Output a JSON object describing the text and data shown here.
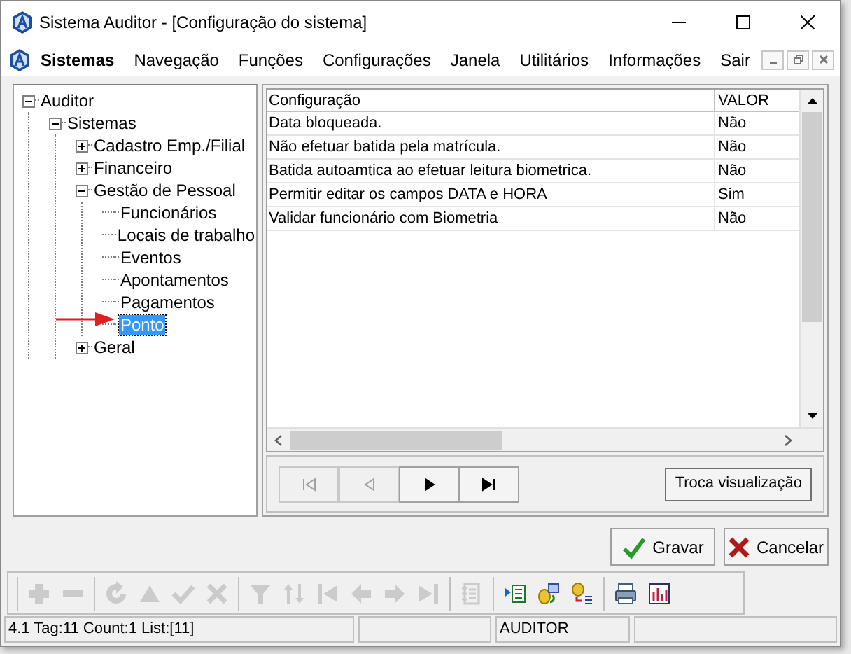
{
  "window": {
    "title": "Sistema Auditor - [Configuração do sistema]"
  },
  "menu": [
    {
      "label": "Sistemas",
      "selected": true
    },
    {
      "label": "Navegação",
      "selected": false
    },
    {
      "label": "Funções",
      "selected": false
    },
    {
      "label": "Configurações",
      "selected": false
    },
    {
      "label": "Janela",
      "selected": false
    },
    {
      "label": "Utilitários",
      "selected": false
    },
    {
      "label": "Informações",
      "selected": false
    },
    {
      "label": "Sair",
      "selected": false
    }
  ],
  "tree": [
    {
      "label": "Auditor",
      "expanded": true,
      "selected": false,
      "children": [
        {
          "label": "Sistemas",
          "expanded": true,
          "selected": false,
          "children": [
            {
              "label": "Cadastro Emp./Filial",
              "expanded": false,
              "selected": false
            },
            {
              "label": "Financeiro",
              "expanded": false,
              "selected": false
            },
            {
              "label": "Gestão de Pessoal",
              "expanded": true,
              "selected": false,
              "children": [
                {
                  "label": "Funcionários",
                  "selected": false
                },
                {
                  "label": "Locais de trabalho",
                  "selected": false
                },
                {
                  "label": "Eventos",
                  "selected": false
                },
                {
                  "label": "Apontamentos",
                  "selected": false
                },
                {
                  "label": "Pagamentos",
                  "selected": false
                },
                {
                  "label": "Ponto",
                  "selected": true
                }
              ]
            },
            {
              "label": "Geral",
              "expanded": false,
              "selected": false
            }
          ]
        }
      ]
    }
  ],
  "table": {
    "columns": [
      "Configuração",
      "VALOR"
    ],
    "rows": [
      [
        "Data bloqueada.",
        "Não"
      ],
      [
        "Não efetuar batida pela matrícula.",
        "Não"
      ],
      [
        "Batida autoamtica ao efetuar leitura biometrica.",
        "Não"
      ],
      [
        "Permitir editar os campos DATA e HORA",
        "Sim"
      ],
      [
        "Validar funcionário com Biometria",
        "Não"
      ]
    ]
  },
  "navigator": [
    {
      "kind": "first",
      "disabled": true
    },
    {
      "kind": "prior",
      "disabled": true
    },
    {
      "kind": "next",
      "disabled": false
    },
    {
      "kind": "last",
      "disabled": false
    }
  ],
  "toggle_view_button": "Troca visualização",
  "actions": [
    {
      "label": "Gravar",
      "kind": "save"
    },
    {
      "label": "Cancelar",
      "kind": "cancel"
    }
  ],
  "toolbar": [
    [
      {
        "kind": "plus",
        "disabled": true
      },
      {
        "kind": "minus",
        "disabled": true
      }
    ],
    [
      {
        "kind": "refresh",
        "disabled": true
      },
      {
        "kind": "up",
        "disabled": true
      },
      {
        "kind": "check",
        "disabled": true
      },
      {
        "kind": "x",
        "disabled": true
      }
    ],
    [
      {
        "kind": "filter",
        "disabled": true
      },
      {
        "kind": "sort",
        "disabled": true
      },
      {
        "kind": "first",
        "disabled": true
      },
      {
        "kind": "left",
        "disabled": true
      },
      {
        "kind": "right",
        "disabled": true
      },
      {
        "kind": "last",
        "disabled": true
      }
    ],
    [
      {
        "kind": "notes",
        "disabled": true
      }
    ],
    [
      {
        "kind": "list",
        "disabled": false
      },
      {
        "kind": "db-transfer",
        "disabled": false
      },
      {
        "kind": "db-list",
        "disabled": false
      }
    ],
    [
      {
        "kind": "print",
        "disabled": false
      },
      {
        "kind": "chart",
        "disabled": false
      }
    ]
  ],
  "status_bar": {
    "info": "4.1 Tag:11 Count:1 List:[11]",
    "user": "AUDITOR"
  }
}
